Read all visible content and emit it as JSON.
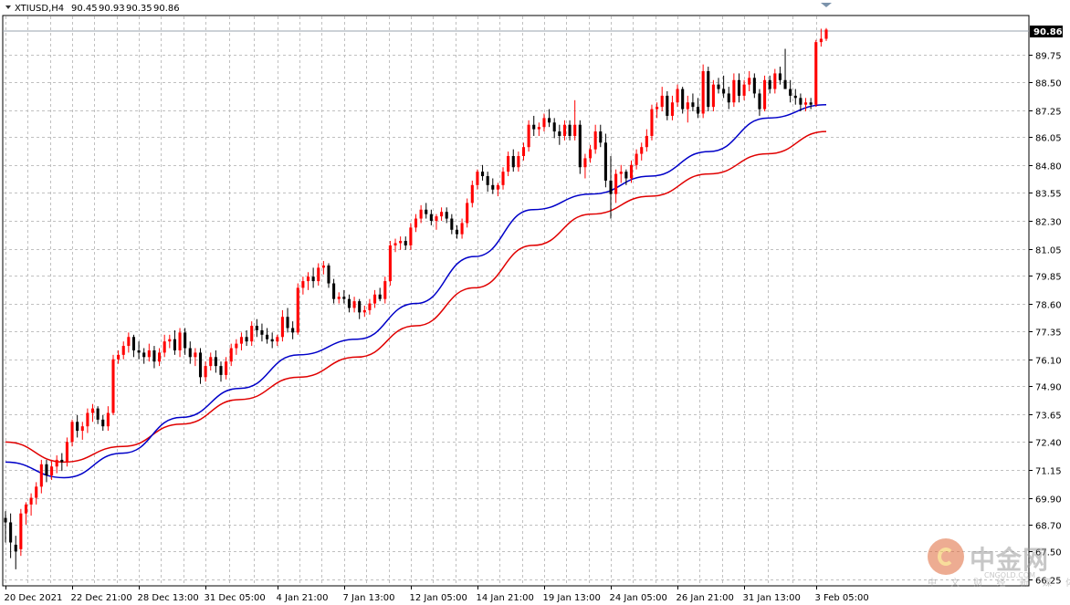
{
  "header": {
    "symbol": "XTIUSD,H4",
    "open": "90.45",
    "high": "90.93",
    "low": "90.35",
    "close": "90.86"
  },
  "price_box": "90.86",
  "watermark": {
    "name": "中金网",
    "sub": "中 文 财 经 新 媒 体",
    "url": "CNGOLD.COM"
  },
  "colors": {
    "bull": "#ff0000",
    "bear": "#000000",
    "ma_fast": "#0000c8",
    "ma_slow": "#e00000",
    "grid": "#c0c0c0",
    "price_box_bg": "#000000"
  },
  "chart_data": {
    "type": "candlestick",
    "title": "XTIUSD,H4",
    "ylim": [
      66.0,
      91.45
    ],
    "y_ticks": [
      "66.25",
      "67.50",
      "68.70",
      "69.90",
      "71.15",
      "72.40",
      "73.65",
      "74.90",
      "76.10",
      "77.35",
      "78.60",
      "79.85",
      "81.05",
      "82.30",
      "83.55",
      "84.80",
      "86.05",
      "87.25",
      "88.50",
      "89.75"
    ],
    "x_labels": [
      "20 Dec 2021",
      "22 Dec 21:00",
      "28 Dec 13:00",
      "31 Dec 05:00",
      "4 Jan 21:00",
      "7 Jan 13:00",
      "12 Jan 05:00",
      "14 Jan 21:00",
      "19 Jan 13:00",
      "24 Jan 05:00",
      "26 Jan 21:00",
      "31 Jan 13:00",
      "3 Feb 05:00"
    ],
    "grid": true,
    "candles": [
      [
        69.0,
        69.3,
        67.9,
        68.8
      ],
      [
        68.8,
        69.2,
        67.2,
        67.9
      ],
      [
        67.8,
        68.2,
        66.7,
        67.5
      ],
      [
        67.6,
        69.4,
        67.3,
        69.2
      ],
      [
        69.2,
        69.7,
        68.7,
        69.6
      ],
      [
        69.6,
        70.1,
        69.1,
        69.9
      ],
      [
        69.9,
        70.6,
        69.6,
        70.4
      ],
      [
        70.4,
        71.6,
        70.1,
        71.4
      ],
      [
        71.4,
        71.6,
        70.6,
        70.9
      ],
      [
        70.9,
        71.6,
        70.7,
        71.3
      ],
      [
        71.3,
        71.8,
        71.0,
        71.6
      ],
      [
        71.6,
        71.9,
        71.1,
        71.5
      ],
      [
        71.5,
        72.6,
        71.3,
        72.4
      ],
      [
        72.4,
        73.4,
        72.2,
        73.3
      ],
      [
        73.3,
        73.6,
        72.6,
        72.9
      ],
      [
        72.9,
        73.3,
        72.5,
        73.1
      ],
      [
        73.1,
        73.9,
        72.8,
        73.7
      ],
      [
        73.7,
        74.1,
        73.3,
        73.9
      ],
      [
        73.9,
        74.0,
        73.2,
        73.4
      ],
      [
        73.4,
        73.6,
        72.9,
        73.1
      ],
      [
        73.1,
        74.0,
        72.9,
        73.7
      ],
      [
        73.7,
        76.3,
        73.6,
        76.1
      ],
      [
        76.1,
        76.5,
        75.9,
        76.3
      ],
      [
        76.3,
        76.9,
        76.1,
        76.7
      ],
      [
        76.7,
        77.3,
        76.4,
        77.1
      ],
      [
        77.1,
        77.2,
        76.2,
        76.5
      ],
      [
        76.5,
        76.9,
        76.1,
        76.4
      ],
      [
        76.4,
        76.6,
        75.9,
        76.2
      ],
      [
        76.2,
        76.8,
        76.0,
        76.5
      ],
      [
        76.5,
        76.7,
        75.7,
        76.0
      ],
      [
        76.0,
        76.6,
        75.8,
        76.4
      ],
      [
        76.4,
        77.2,
        76.2,
        76.9
      ],
      [
        76.9,
        77.2,
        76.6,
        77.0
      ],
      [
        77.0,
        77.4,
        76.3,
        76.5
      ],
      [
        76.5,
        77.5,
        76.2,
        77.3
      ],
      [
        77.3,
        77.5,
        76.3,
        76.6
      ],
      [
        76.6,
        76.9,
        75.9,
        76.2
      ],
      [
        76.2,
        76.6,
        75.8,
        76.4
      ],
      [
        76.4,
        76.6,
        75.0,
        75.3
      ],
      [
        75.3,
        76.0,
        75.1,
        75.8
      ],
      [
        75.8,
        76.4,
        75.6,
        76.2
      ],
      [
        76.2,
        76.5,
        75.5,
        75.8
      ],
      [
        75.8,
        76.0,
        75.1,
        75.4
      ],
      [
        75.4,
        76.2,
        75.2,
        76.0
      ],
      [
        76.0,
        76.8,
        75.8,
        76.6
      ],
      [
        76.6,
        77.0,
        76.3,
        76.8
      ],
      [
        76.8,
        77.3,
        76.5,
        77.1
      ],
      [
        77.1,
        77.4,
        76.7,
        76.9
      ],
      [
        76.9,
        77.8,
        76.7,
        77.6
      ],
      [
        77.6,
        77.9,
        77.1,
        77.4
      ],
      [
        77.4,
        77.7,
        76.9,
        77.2
      ],
      [
        77.2,
        77.5,
        76.8,
        77.0
      ],
      [
        77.0,
        77.3,
        76.6,
        76.9
      ],
      [
        76.9,
        77.2,
        76.7,
        77.1
      ],
      [
        77.1,
        78.3,
        76.9,
        78.0
      ],
      [
        78.0,
        78.4,
        77.3,
        77.5
      ],
      [
        77.5,
        77.8,
        77.0,
        77.3
      ],
      [
        77.3,
        79.5,
        77.2,
        79.3
      ],
      [
        79.3,
        79.8,
        79.0,
        79.6
      ],
      [
        79.6,
        80.0,
        79.2,
        79.8
      ],
      [
        79.8,
        80.2,
        79.3,
        79.6
      ],
      [
        79.6,
        80.4,
        79.4,
        80.2
      ],
      [
        80.2,
        80.5,
        79.9,
        80.3
      ],
      [
        80.3,
        80.4,
        79.3,
        79.5
      ],
      [
        79.5,
        79.7,
        78.6,
        78.8
      ],
      [
        78.8,
        79.1,
        78.6,
        78.9
      ],
      [
        78.9,
        79.2,
        78.6,
        78.8
      ],
      [
        78.8,
        79.0,
        78.2,
        78.4
      ],
      [
        78.4,
        78.9,
        78.2,
        78.7
      ],
      [
        78.7,
        78.8,
        77.9,
        78.2
      ],
      [
        78.2,
        78.5,
        78.0,
        78.3
      ],
      [
        78.3,
        78.8,
        78.1,
        78.6
      ],
      [
        78.6,
        79.2,
        78.4,
        79.0
      ],
      [
        79.0,
        79.3,
        78.7,
        78.8
      ],
      [
        78.8,
        79.8,
        78.6,
        79.6
      ],
      [
        79.6,
        81.4,
        79.4,
        81.2
      ],
      [
        81.2,
        81.5,
        80.9,
        81.3
      ],
      [
        81.3,
        81.6,
        81.0,
        81.4
      ],
      [
        81.4,
        81.6,
        81.0,
        81.2
      ],
      [
        81.2,
        82.2,
        81.0,
        82.0
      ],
      [
        82.0,
        82.6,
        81.8,
        82.4
      ],
      [
        82.4,
        83.0,
        82.2,
        82.8
      ],
      [
        82.8,
        83.1,
        82.4,
        82.6
      ],
      [
        82.6,
        82.8,
        82.1,
        82.3
      ],
      [
        82.3,
        82.6,
        81.9,
        82.5
      ],
      [
        82.5,
        82.9,
        82.3,
        82.7
      ],
      [
        82.7,
        82.9,
        82.2,
        82.4
      ],
      [
        82.4,
        82.6,
        81.7,
        81.9
      ],
      [
        81.9,
        82.1,
        81.5,
        81.7
      ],
      [
        81.7,
        82.4,
        81.5,
        82.2
      ],
      [
        82.2,
        83.3,
        82.0,
        83.1
      ],
      [
        83.1,
        84.1,
        82.9,
        83.9
      ],
      [
        83.9,
        84.6,
        83.7,
        84.5
      ],
      [
        84.5,
        84.8,
        84.1,
        84.3
      ],
      [
        84.3,
        84.5,
        83.6,
        83.9
      ],
      [
        83.9,
        84.2,
        83.5,
        83.7
      ],
      [
        83.7,
        84.0,
        83.4,
        83.9
      ],
      [
        83.9,
        84.7,
        83.7,
        84.5
      ],
      [
        84.5,
        85.4,
        84.3,
        85.2
      ],
      [
        85.2,
        85.5,
        84.5,
        84.7
      ],
      [
        84.7,
        85.4,
        84.5,
        85.2
      ],
      [
        85.2,
        85.8,
        85.0,
        85.6
      ],
      [
        85.6,
        86.8,
        85.4,
        86.6
      ],
      [
        86.6,
        87.0,
        86.1,
        86.4
      ],
      [
        86.4,
        86.7,
        86.1,
        86.5
      ],
      [
        86.5,
        87.1,
        86.3,
        86.9
      ],
      [
        86.9,
        87.3,
        86.5,
        86.7
      ],
      [
        86.7,
        86.9,
        86.0,
        86.3
      ],
      [
        86.3,
        86.6,
        85.7,
        86.1
      ],
      [
        86.1,
        86.8,
        85.9,
        86.6
      ],
      [
        86.6,
        86.8,
        85.9,
        86.1
      ],
      [
        86.1,
        87.7,
        85.9,
        86.6
      ],
      [
        86.6,
        86.8,
        84.4,
        84.7
      ],
      [
        84.7,
        85.3,
        84.2,
        85.1
      ],
      [
        85.1,
        85.7,
        84.9,
        85.5
      ],
      [
        85.5,
        86.6,
        85.3,
        86.3
      ],
      [
        86.3,
        86.6,
        85.6,
        85.8
      ],
      [
        85.8,
        86.2,
        83.8,
        84.1
      ],
      [
        84.1,
        85.2,
        82.4,
        83.5
      ],
      [
        83.5,
        84.6,
        83.1,
        84.4
      ],
      [
        84.4,
        84.8,
        84.0,
        84.5
      ],
      [
        84.5,
        84.6,
        83.9,
        84.2
      ],
      [
        84.2,
        85.0,
        84.0,
        84.8
      ],
      [
        84.8,
        85.5,
        84.6,
        85.3
      ],
      [
        85.3,
        85.8,
        85.0,
        85.6
      ],
      [
        85.6,
        86.4,
        85.4,
        86.1
      ],
      [
        86.1,
        87.5,
        85.9,
        87.3
      ],
      [
        87.3,
        87.6,
        86.9,
        87.4
      ],
      [
        87.4,
        88.3,
        87.2,
        87.9
      ],
      [
        87.9,
        88.1,
        86.8,
        87.0
      ],
      [
        87.0,
        87.9,
        86.8,
        87.6
      ],
      [
        87.6,
        88.4,
        87.4,
        88.2
      ],
      [
        88.2,
        88.3,
        87.1,
        87.3
      ],
      [
        87.3,
        87.9,
        86.7,
        87.6
      ],
      [
        87.6,
        88.0,
        87.2,
        87.4
      ],
      [
        87.4,
        87.8,
        86.9,
        87.1
      ],
      [
        87.1,
        89.3,
        86.9,
        89.0
      ],
      [
        89.0,
        89.2,
        87.2,
        87.4
      ],
      [
        87.4,
        88.6,
        87.2,
        88.4
      ],
      [
        88.4,
        88.7,
        88.0,
        88.2
      ],
      [
        88.2,
        88.8,
        87.8,
        88.0
      ],
      [
        88.0,
        88.3,
        87.3,
        87.6
      ],
      [
        87.6,
        88.9,
        87.4,
        88.6
      ],
      [
        88.6,
        88.9,
        87.6,
        87.9
      ],
      [
        87.9,
        88.6,
        87.7,
        88.4
      ],
      [
        88.4,
        89.0,
        88.1,
        88.7
      ],
      [
        88.7,
        88.9,
        87.8,
        88.0
      ],
      [
        88.0,
        88.2,
        87.0,
        87.3
      ],
      [
        87.3,
        88.8,
        87.2,
        88.6
      ],
      [
        88.6,
        88.8,
        88.0,
        88.2
      ],
      [
        88.2,
        89.1,
        88.0,
        88.9
      ],
      [
        88.9,
        89.2,
        88.4,
        88.6
      ],
      [
        88.6,
        90.0,
        88.4,
        88.2
      ],
      [
        88.2,
        88.6,
        87.6,
        87.9
      ],
      [
        87.9,
        88.2,
        87.5,
        87.8
      ],
      [
        87.8,
        88.0,
        87.2,
        87.5
      ],
      [
        87.5,
        87.8,
        87.2,
        87.6
      ],
      [
        87.6,
        87.8,
        87.3,
        87.5
      ],
      [
        87.5,
        90.4,
        87.4,
        90.3
      ],
      [
        90.3,
        90.9,
        90.1,
        90.45
      ],
      [
        90.45,
        90.93,
        90.35,
        90.86
      ]
    ],
    "ma_fast_anchor_values": [
      71.5,
      70.8,
      71.9,
      73.5,
      74.8,
      76.3,
      77.0,
      78.6,
      80.7,
      82.8,
      83.5,
      84.3,
      85.4,
      86.9,
      87.5
    ],
    "ma_slow_anchor_values": [
      72.4,
      71.5,
      72.2,
      73.2,
      74.3,
      75.3,
      76.2,
      77.6,
      79.3,
      81.2,
      82.6,
      83.4,
      84.4,
      85.3,
      86.3
    ]
  }
}
